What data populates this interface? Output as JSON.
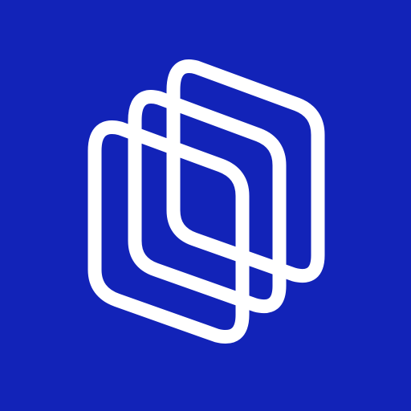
{
  "background_color": "#1223B8",
  "logo": {
    "icon": "stacked-layers-logo-icon",
    "stroke_color": "#FFFFFF",
    "layers": 3
  }
}
